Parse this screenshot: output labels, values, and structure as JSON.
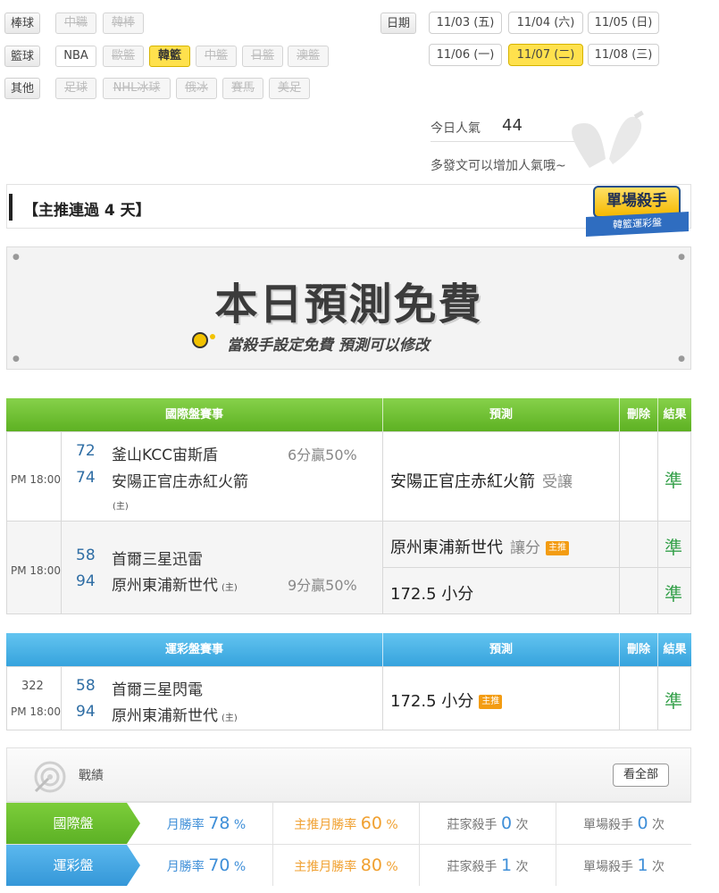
{
  "filters": {
    "baseball": {
      "label": "棒球",
      "items": [
        {
          "label": "中職",
          "state": "disabled"
        },
        {
          "label": "韓棒",
          "state": "disabled"
        }
      ]
    },
    "basketball": {
      "label": "籃球",
      "items": [
        {
          "label": "NBA",
          "state": "normal"
        },
        {
          "label": "歐籃",
          "state": "disabled"
        },
        {
          "label": "韓籃",
          "state": "selected"
        },
        {
          "label": "中籃",
          "state": "disabled"
        },
        {
          "label": "日籃",
          "state": "disabled"
        },
        {
          "label": "澳籃",
          "state": "disabled"
        }
      ]
    },
    "other": {
      "label": "其他",
      "items": [
        {
          "label": "足球",
          "state": "disabled"
        },
        {
          "label": "NHL冰球",
          "state": "disabled"
        },
        {
          "label": "俄冰",
          "state": "disabled"
        },
        {
          "label": "賽馬",
          "state": "disabled"
        },
        {
          "label": "美足",
          "state": "disabled"
        }
      ]
    }
  },
  "dates": {
    "label": "日期",
    "items": [
      "11/03 (五)",
      "11/04 (六)",
      "11/05 (日)",
      "11/06 (一)",
      "11/07 (二)",
      "11/08 (三)"
    ],
    "selected": "11/07 (二)"
  },
  "popularity": {
    "label": "今日人氣",
    "value": "44",
    "hint": "多發文可以增加人氣哦~"
  },
  "streak": {
    "title": "【主推連過 4 天】",
    "badge_main": "單場殺手",
    "badge_sub": "韓籃運彩盤"
  },
  "banner": {
    "title": "本日預測免費",
    "subtitle": "當殺手設定免費 預測可以修改"
  },
  "intl_table": {
    "headers": {
      "event": "國際盤賽事",
      "prediction": "預測",
      "delete": "刪除",
      "result": "結果"
    },
    "games": [
      {
        "time": "PM 18:00",
        "away_no": "72",
        "away": "釜山KCC宙斯盾",
        "home_no": "74",
        "home": "安陽正官庄赤紅火箭",
        "host_mark": "(主)",
        "spread": "6分贏50%",
        "picks": [
          {
            "pick": "安陽正官庄赤紅火箭",
            "type": "受讓",
            "main": "",
            "result": "準"
          }
        ]
      },
      {
        "time": "PM 18:00",
        "away_no": "58",
        "away": "首爾三星迅雷",
        "home_no": "94",
        "home": "原州東浦新世代",
        "host_mark": "(主)",
        "spread": "9分贏50%",
        "picks": [
          {
            "pick": "原州東浦新世代",
            "type": "讓分",
            "main": "主推",
            "result": "準"
          },
          {
            "pick": "172.5 小分",
            "type": "",
            "main": "",
            "result": "準"
          }
        ]
      }
    ]
  },
  "lottery_table": {
    "headers": {
      "event": "運彩盤賽事",
      "prediction": "預測",
      "delete": "刪除",
      "result": "結果"
    },
    "games": [
      {
        "code": "322",
        "time": "PM 18:00",
        "away_no": "58",
        "away": "首爾三星閃電",
        "home_no": "94",
        "home": "原州東浦新世代",
        "host_mark": "(主)",
        "pick": "172.5 小分",
        "main": "主推",
        "result": "準"
      }
    ]
  },
  "record": {
    "title": "戰績",
    "view_all": "看全部",
    "rows": [
      {
        "tag": "國際盤",
        "color": "#6cbf2a",
        "month_label": "月勝率",
        "month": "78",
        "main_label": "主推月勝率",
        "main": "60",
        "dealer_label": "莊家殺手",
        "dealer": "0",
        "single_label": "單場殺手",
        "single": "0",
        "pct": "%",
        "times": "次"
      },
      {
        "tag": "運彩盤",
        "color": "#3f9fe0",
        "month_label": "月勝率",
        "month": "70",
        "main_label": "主推月勝率",
        "main": "80",
        "dealer_label": "莊家殺手",
        "dealer": "1",
        "single_label": "單場殺手",
        "single": "1",
        "pct": "%",
        "times": "次"
      }
    ]
  },
  "colors": {
    "green": "#6cbf2a",
    "blue": "#3fa6e0",
    "yellow": "#ffe14d",
    "result": "#35a04a"
  }
}
